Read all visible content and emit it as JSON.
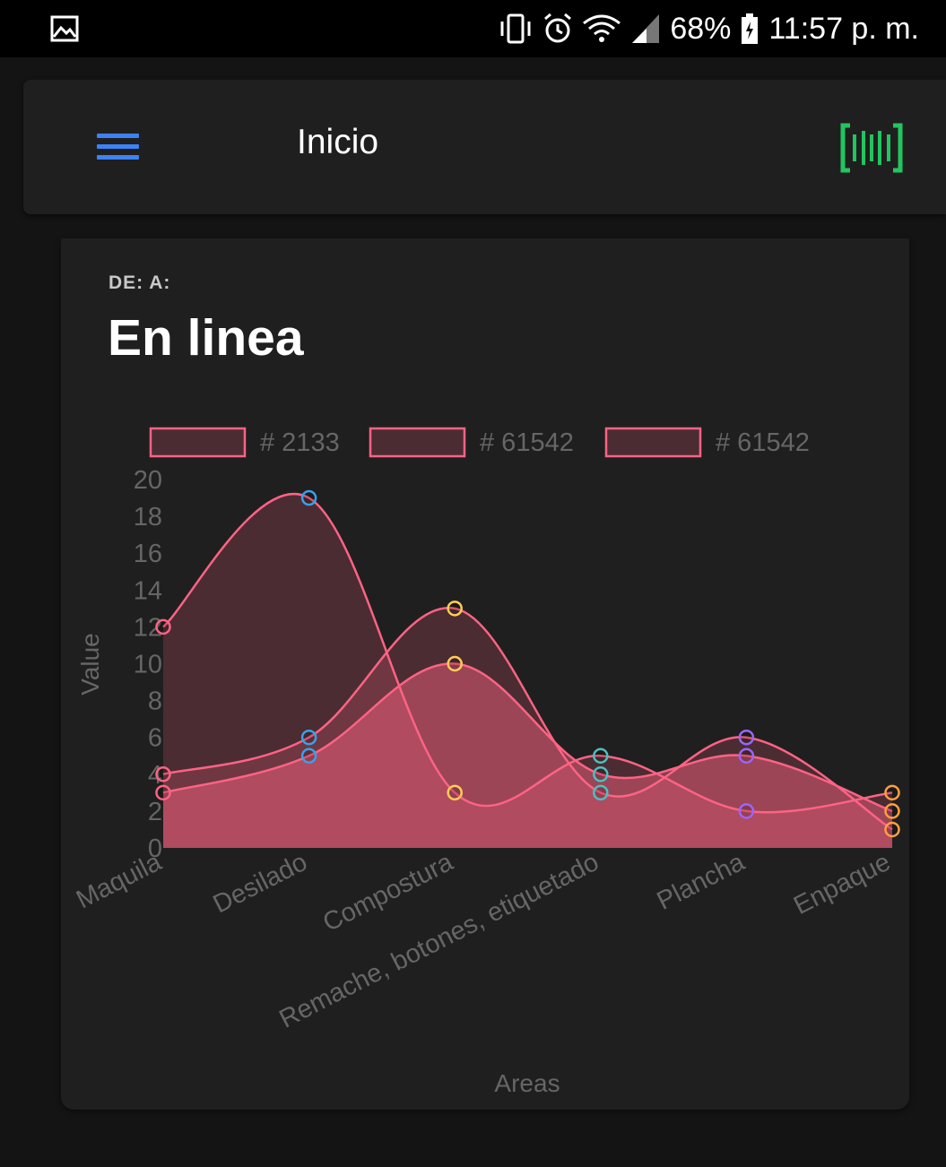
{
  "status_bar": {
    "battery": "68%",
    "time": "11:57 p. m.",
    "icons": [
      "gallery-icon",
      "vibrate-icon",
      "alarm-icon",
      "wifi-icon",
      "signal-icon",
      "battery-icon"
    ]
  },
  "app_bar": {
    "title": "Inicio",
    "menu_icon": "hamburger-menu-icon",
    "scan_icon": "barcode-scan-icon",
    "colors": {
      "menu": "#3b82f6",
      "scan": "#22c55e"
    }
  },
  "card": {
    "subtitle": "DE: A:",
    "title": "En linea"
  },
  "chart_data": {
    "type": "area",
    "categories": [
      "Maquila",
      "Desilado",
      "Compostura",
      "Remache, botones, etiquetado",
      "Plancha",
      "Enpaque"
    ],
    "xlabel": "Areas",
    "ylabel": "Value",
    "ylim": [
      0,
      20
    ],
    "yticks": [
      0,
      2,
      4,
      6,
      8,
      10,
      12,
      14,
      16,
      18,
      20
    ],
    "legend_position": "top",
    "line_color": "#ff6384",
    "point_colors": [
      "#ff6384",
      "#36a2eb",
      "#ffcd56",
      "#4bc0c0",
      "#9966ff",
      "#ff9f40"
    ],
    "series": [
      {
        "name": "# 2133",
        "values": [
          12,
          19,
          3,
          5,
          2,
          3
        ],
        "fill": "rgba(255,99,132,0.2)"
      },
      {
        "name": "# 61542",
        "values": [
          4,
          6,
          13,
          3,
          6,
          1
        ],
        "fill": "rgba(255,99,132,0.2)"
      },
      {
        "name": "# 61542",
        "values": [
          3,
          5,
          10,
          4,
          5,
          2
        ],
        "fill": "rgba(255,99,132,0.45)"
      }
    ]
  }
}
